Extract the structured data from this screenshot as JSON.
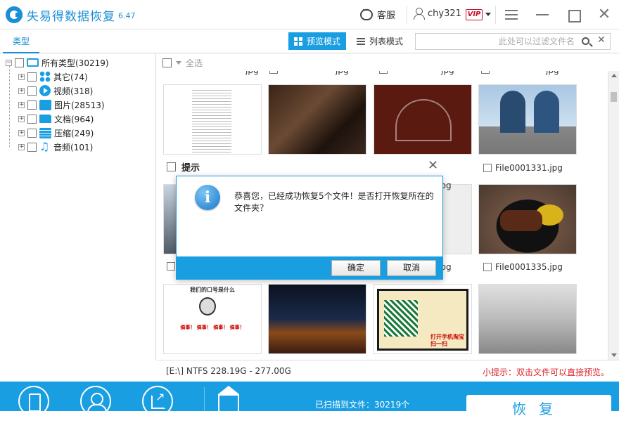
{
  "app": {
    "title": "失易得数据恢复",
    "version": "6.47",
    "service_label": "客服",
    "username": "chy321",
    "vip_label": "VIP",
    "icons": [
      "logo-icon",
      "chat-bubble-icon",
      "user-icon",
      "menu-icon",
      "minimize-icon",
      "maximize-icon",
      "close-icon"
    ]
  },
  "toolbar": {
    "type_tab": "类型",
    "preview_mode": "预览模式",
    "list_mode": "列表模式",
    "filter_placeholder": "此处可以过滤文件名",
    "clear_symbol": "✕"
  },
  "tree": {
    "root": "所有类型(30219)",
    "items": [
      {
        "label": "其它(74)",
        "icon": "other-icon"
      },
      {
        "label": "视频(318)",
        "icon": "video-icon"
      },
      {
        "label": "图片(28513)",
        "icon": "picture-icon"
      },
      {
        "label": "文档(964)",
        "icon": "document-icon"
      },
      {
        "label": "压缩(249)",
        "icon": "archive-icon"
      },
      {
        "label": "音频(101)",
        "icon": "audio-icon"
      }
    ]
  },
  "panel": {
    "select_all": "全选",
    "top_row_partial": [
      "jpg",
      "jpg",
      "jpg",
      "jpg"
    ],
    "row2_names": [
      "",
      "",
      "jpg",
      "File0001331.jpg"
    ],
    "row3_names": [
      "",
      "",
      "jpg",
      "File0001335.jpg"
    ],
    "thumb4_caption": "我们的口号是什么",
    "thumb4_sub": "搞事！  搞事！  搞事！  搞事！",
    "thumb11_label": "打开手机淘宝扫一扫"
  },
  "dialog": {
    "title": "提示",
    "message": "恭喜您，已经成功恢复5个文件！是否打开恢复所在的文件夹？",
    "ok": "确定",
    "cancel": "取消",
    "info_glyph": "i"
  },
  "status": {
    "disk": "[E:\\] NTFS 228.19G - 277.00G",
    "tip": "小提示：双击文件可以直接预览。"
  },
  "bottom": {
    "scanned": "已扫描到文件：30219个",
    "recover": "恢复"
  },
  "colors": {
    "accent": "#1a9ee2",
    "brand": "#1a8fd6",
    "tip": "#d9262c",
    "vip": "#c8102e"
  }
}
